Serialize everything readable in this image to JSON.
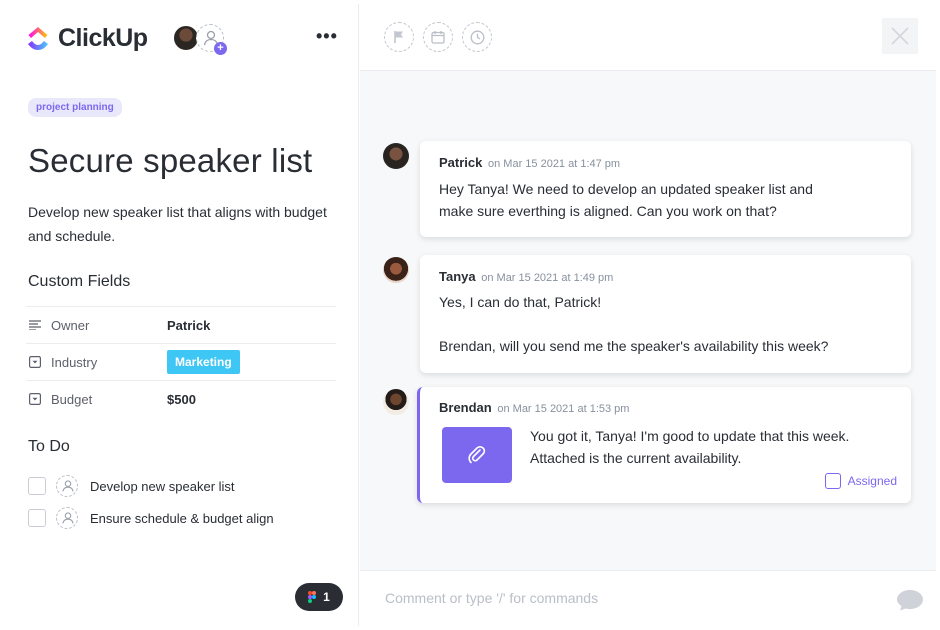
{
  "app": {
    "brand_name": "ClickUp",
    "accent": "#7b68ee"
  },
  "task": {
    "tag": "project planning",
    "title": "Secure speaker list",
    "description": "Develop new speaker list that aligns with budget and schedule.",
    "more_label": "•••"
  },
  "custom_fields": {
    "heading": "Custom Fields",
    "rows": [
      {
        "label": "Owner",
        "value": "Patrick",
        "icon": "text-lines-icon"
      },
      {
        "label": "Industry",
        "value": "Marketing",
        "icon": "dropdown-icon",
        "color": "#3ec6f5"
      },
      {
        "label": "Budget",
        "value": "$500",
        "icon": "dropdown-icon"
      }
    ]
  },
  "todo": {
    "heading": "To Do",
    "items": [
      {
        "text": "Develop new speaker list"
      },
      {
        "text": "Ensure schedule & budget align"
      }
    ]
  },
  "figma_badge": {
    "count": "1"
  },
  "toolbar": {
    "icons": [
      "flag-icon",
      "calendar-icon",
      "clock-icon",
      "close-icon"
    ]
  },
  "comments": [
    {
      "author": "Patrick",
      "meta": "on Mar 15 2021 at 1:47 pm",
      "lines": [
        "Hey Tanya! We need to develop an updated speaker list and",
        "make sure everthing is aligned. Can you work on that?"
      ]
    },
    {
      "author": "Tanya",
      "meta": "on Mar 15 2021 at 1:49 pm",
      "lines": [
        "Yes, I can do that, Patrick!",
        "",
        "Brendan, will you send me the speaker's availability this week?"
      ]
    },
    {
      "author": "Brendan",
      "meta": "on Mar 15 2021 at 1:53 pm",
      "lines": [
        "You got it, Tanya! I'm good to update that this week.",
        "Attached is the current availability."
      ],
      "attachment_icon": "paperclip-icon",
      "assigned_label": "Assigned"
    }
  ],
  "composer": {
    "placeholder": "Comment or type '/' for commands"
  }
}
